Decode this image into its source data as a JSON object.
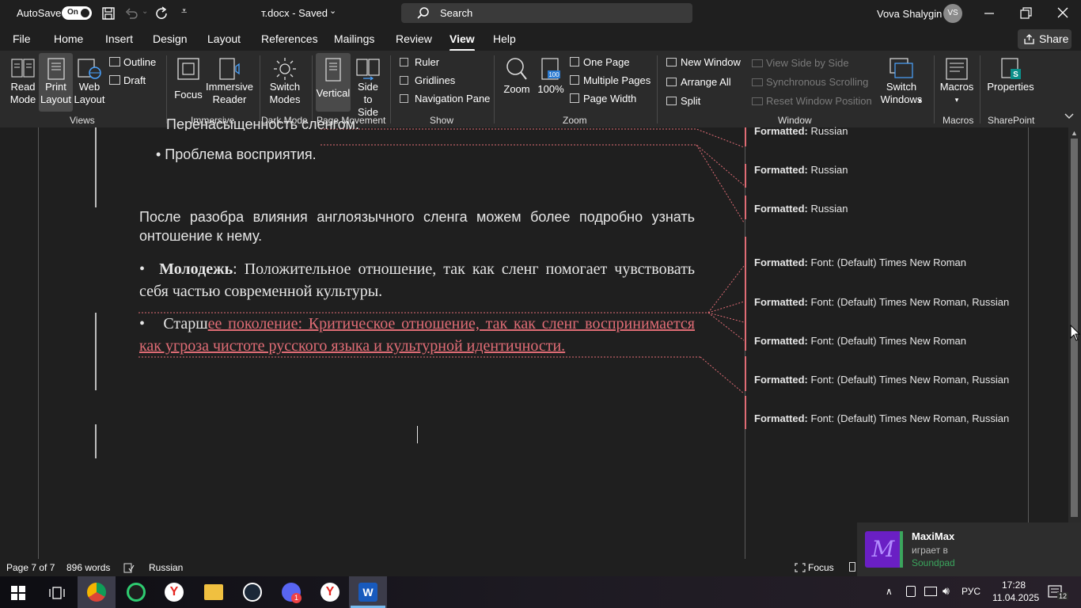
{
  "titlebar": {
    "autosave_label": "AutoSave",
    "autosave_state": "On",
    "doc_title": "т.docx  -  Saved",
    "search_label": "Search",
    "user_name": "Vova Shalygin",
    "user_initials": "VS"
  },
  "tabs": [
    "File",
    "Home",
    "Insert",
    "Design",
    "Layout",
    "References",
    "Mailings",
    "Review",
    "View",
    "Help"
  ],
  "share_label": "Share",
  "ribbon": {
    "read_mode": [
      "Read",
      "Mode"
    ],
    "print_layout": [
      "Print",
      "Layout"
    ],
    "web_layout": [
      "Web",
      "Layout"
    ],
    "outline": "Outline",
    "draft": "Draft",
    "views_group": "Views",
    "focus": "Focus",
    "immersive_reader": [
      "Immersive",
      "Reader"
    ],
    "immersive_group": "Immersive",
    "switch_modes": [
      "Switch",
      "Modes"
    ],
    "dark_mode_group": "Dark Mode",
    "vertical": "Vertical",
    "side_to_side": [
      "Side",
      "to Side"
    ],
    "page_movement_group": "Page Movement",
    "ruler": "Ruler",
    "gridlines": "Gridlines",
    "navigation_pane": "Navigation Pane",
    "show_group": "Show",
    "zoom": "Zoom",
    "zoom_100": "100%",
    "one_page": "One Page",
    "multiple_pages": "Multiple Pages",
    "page_width": "Page Width",
    "zoom_group": "Zoom",
    "new_window": "New Window",
    "arrange_all": "Arrange All",
    "split": "Split",
    "view_side_by_side": "View Side by Side",
    "synchronous_scrolling": "Synchronous Scrolling",
    "reset_window_position": "Reset Window Position",
    "switch_windows": [
      "Switch",
      "Windows"
    ],
    "window_group": "Window",
    "macros": "Macros",
    "macros_group": "Macros",
    "properties": "Properties",
    "sharepoint_group": "SharePoint"
  },
  "document": {
    "partial_top_line": "Перенасыщенность сленгом.",
    "bullet_perception": "• Проблема восприятия.",
    "para_after": "После разобра влияния англоязычного сленга можем более подробно узнать онтошение к нему.",
    "youth_bullet": "•",
    "youth_bold": "Молодежь",
    "youth_rest": ": Положительное отношение, так как сленг помогает чувствовать себя частью современной культуры.",
    "older_bullet": "•",
    "older_plain": "Старш",
    "older_inserted": "ее поколение: Критическое отношение, так как сленг воспринимается как угроза чистоте русского языка и культурной идентичности."
  },
  "balloons": [
    {
      "label": "Formatted:",
      "value": "Russian"
    },
    {
      "label": "Formatted:",
      "value": "Russian"
    },
    {
      "label": "Formatted:",
      "value": "Russian"
    },
    {
      "label": "Formatted:",
      "value": "Font: (Default) Times New Roman"
    },
    {
      "label": "Formatted:",
      "value": "Font: (Default) Times New Roman, Russian"
    },
    {
      "label": "Formatted:",
      "value": "Font: (Default) Times New Roman"
    },
    {
      "label": "Formatted:",
      "value": "Font: (Default) Times New Roman, Russian"
    },
    {
      "label": "Formatted:",
      "value": "Font: (Default) Times New Roman, Russian"
    }
  ],
  "status": {
    "page": "Page 7 of 7",
    "words": "896 words",
    "language": "Russian",
    "focus": "Focus"
  },
  "notification": {
    "title": "MaxiMax",
    "line1": "играет в",
    "line2": "Soundpad",
    "avatar_letter": "M"
  },
  "taskbar": {
    "lang": "РУС",
    "time": "17:28",
    "date": "11.04.2025",
    "notif_count": "12",
    "discord_badge": "1"
  },
  "colors": {
    "accent_red": "#e06c75",
    "ribbon_bg": "#2b2b2b",
    "window_bg": "#1f1f1f",
    "notif_accent": "#3ba55d"
  }
}
